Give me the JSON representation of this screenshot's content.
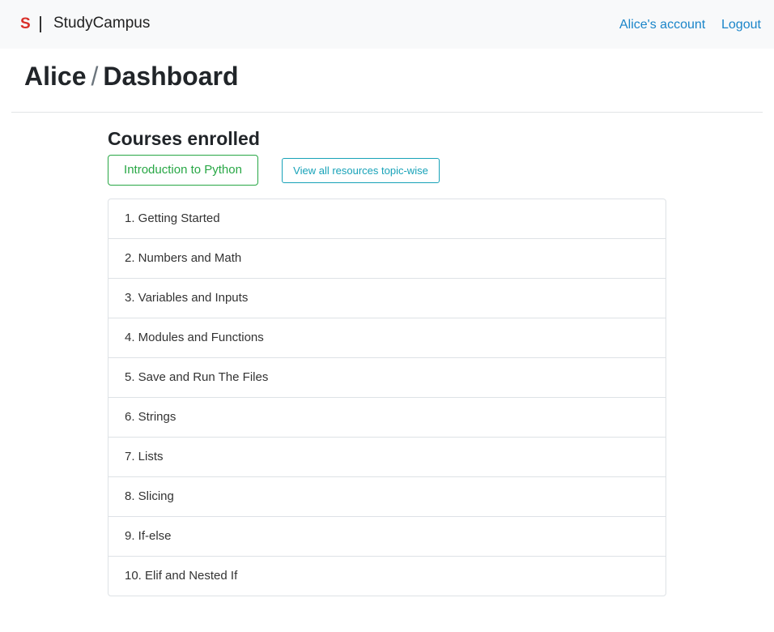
{
  "navbar": {
    "logo_letter": "S",
    "brand_name": "StudyCampus",
    "account_link": "Alice's account",
    "logout_link": "Logout"
  },
  "header": {
    "user": "Alice",
    "separator": "/",
    "page": "Dashboard"
  },
  "courses": {
    "title": "Courses enrolled",
    "course_button": "Introduction to Python",
    "resources_button": "View all resources topic-wise"
  },
  "topics": [
    "1. Getting Started",
    "2. Numbers and Math",
    "3. Variables and Inputs",
    "4. Modules and Functions",
    "5. Save and Run The Files",
    "6. Strings",
    "7. Lists",
    "8. Slicing",
    "9. If-else",
    "10. Elif and Nested If"
  ],
  "colors": {
    "brand_red": "#d9302a",
    "link_blue": "#1a85c9",
    "success_green": "#28a745",
    "info_teal": "#17a2b8"
  }
}
